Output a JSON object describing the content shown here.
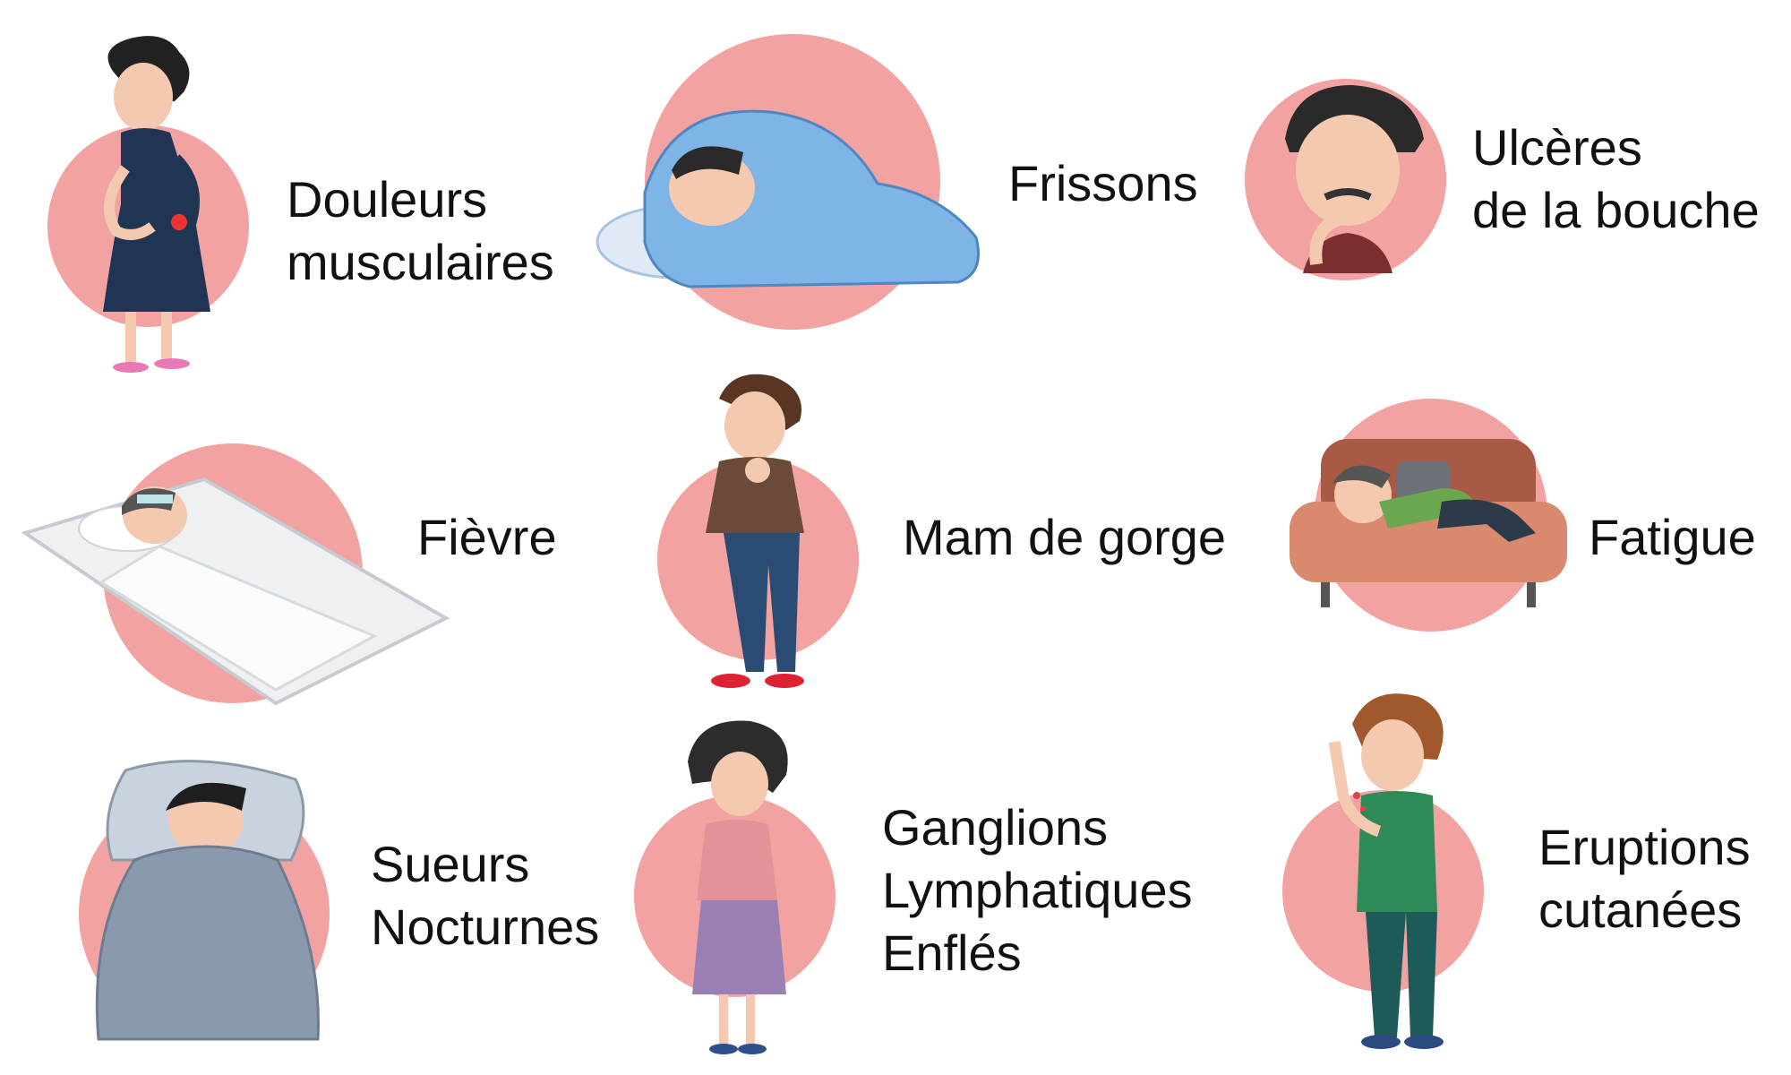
{
  "colors": {
    "circle": "#f2a3a1",
    "text": "#111111"
  },
  "symptoms": [
    {
      "id": "douleurs",
      "lines": [
        "Douleurs",
        "musculaires"
      ],
      "icon": "muscle-pain-woman-illustration"
    },
    {
      "id": "frissons",
      "lines": [
        "Frissons"
      ],
      "icon": "shivering-boy-under-blanket-illustration"
    },
    {
      "id": "ulceres",
      "lines": [
        "Ulcères",
        "de la bouche"
      ],
      "icon": "man-mouth-ulcer-illustration"
    },
    {
      "id": "fievre",
      "lines": [
        "Fièvre"
      ],
      "icon": "feverish-person-in-bed-illustration"
    },
    {
      "id": "gorge",
      "lines": [
        "Mam de gorge"
      ],
      "icon": "boy-sore-throat-illustration"
    },
    {
      "id": "fatigue",
      "lines": [
        "Fatigue"
      ],
      "icon": "tired-man-on-sofa-illustration"
    },
    {
      "id": "sueurs",
      "lines": [
        "Sueurs",
        "Nocturnes"
      ],
      "icon": "child-night-sweats-in-bed-illustration"
    },
    {
      "id": "ganglions",
      "lines": [
        "Ganglions",
        "Lymphatiques",
        "Enflés"
      ],
      "icon": "woman-swollen-neck-illustration"
    },
    {
      "id": "eruptions",
      "lines": [
        "Eruptions",
        "cutanées"
      ],
      "icon": "boy-skin-rash-illustration"
    }
  ]
}
